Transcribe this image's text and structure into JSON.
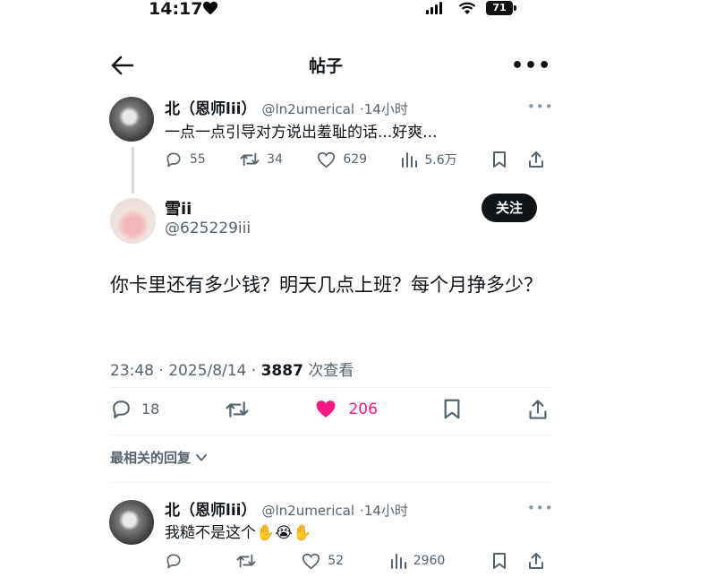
{
  "status_bar": {
    "time": "14:17",
    "battery": "71"
  },
  "header": {
    "title": "帖子"
  },
  "parent_post": {
    "name": "北（恩师lii）",
    "handle": "@ln2umerical",
    "time": "·14小时",
    "text": "一点一点引导对方说出羞耻的话...好爽...",
    "replies": "55",
    "reposts": "34",
    "likes": "629",
    "views": "5.6万"
  },
  "main_post": {
    "name": "雪ii",
    "handle": "@625229iii",
    "follow_label": "关注",
    "text": "你卡里还有多少钱？明天几点上班？每个月挣多少？",
    "timestamp": "23:48 · 2025/8/14 · ",
    "views_count": "3887",
    "views_label": " 次查看",
    "replies": "18",
    "likes": "206",
    "like_color": "#f91880"
  },
  "sort_label": "最相关的回复",
  "reply": {
    "name": "北（恩师lii）",
    "handle": "@ln2umerical",
    "time": "·14小时",
    "text": "我糙不是这个",
    "emojis": "✋😭✋",
    "reply_count": "",
    "likes": "52",
    "views": "2960"
  }
}
